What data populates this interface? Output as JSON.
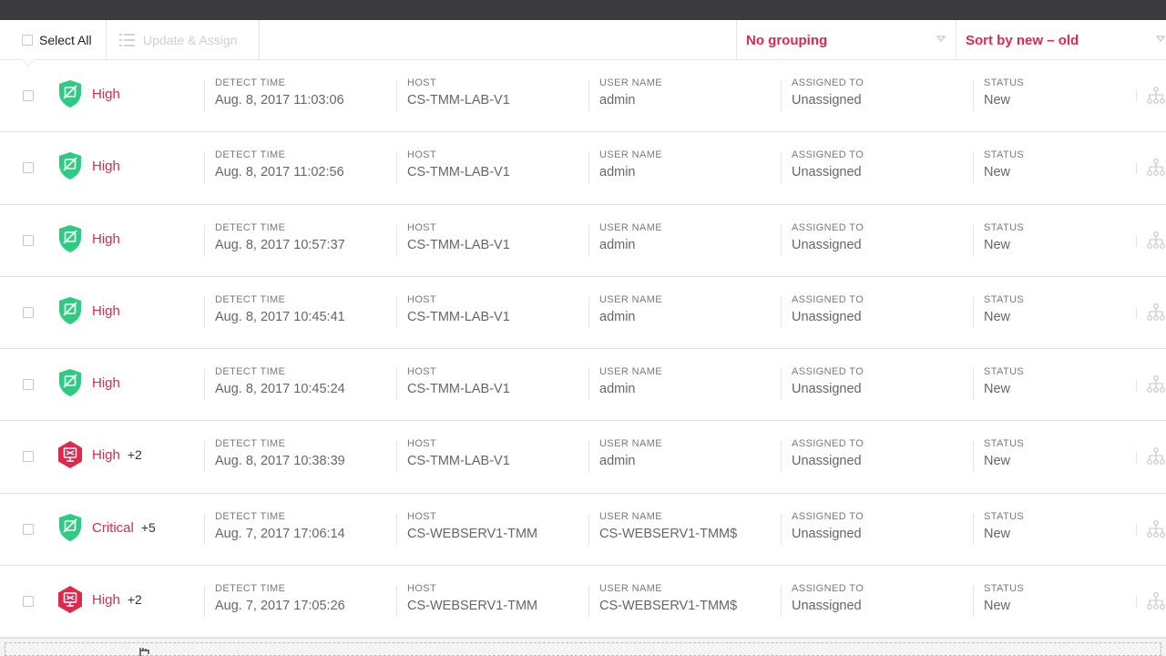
{
  "toolbar": {
    "select_all_label": "Select All",
    "update_assign_label": "Update & Assign",
    "grouping_label": "No grouping",
    "sort_label": "Sort by new – old"
  },
  "columns": {
    "detect_time": "DETECT TIME",
    "host": "HOST",
    "user_name": "USER NAME",
    "assigned_to": "ASSIGNED TO",
    "status": "STATUS"
  },
  "colors": {
    "accent": "#e0284e",
    "green_shield": "#2ecc80",
    "red_hex": "#e0284e"
  },
  "detections": [
    {
      "icon": "green-shield-icon",
      "severity": "High",
      "extra": "",
      "detect_time": "Aug. 8, 2017 11:03:06",
      "host": "CS-TMM-LAB-V1",
      "user_name": "admin",
      "assigned_to": "Unassigned",
      "status": "New"
    },
    {
      "icon": "green-shield-icon",
      "severity": "High",
      "extra": "",
      "detect_time": "Aug. 8, 2017 11:02:56",
      "host": "CS-TMM-LAB-V1",
      "user_name": "admin",
      "assigned_to": "Unassigned",
      "status": "New"
    },
    {
      "icon": "green-shield-icon",
      "severity": "High",
      "extra": "",
      "detect_time": "Aug. 8, 2017 10:57:37",
      "host": "CS-TMM-LAB-V1",
      "user_name": "admin",
      "assigned_to": "Unassigned",
      "status": "New"
    },
    {
      "icon": "green-shield-icon",
      "severity": "High",
      "extra": "",
      "detect_time": "Aug. 8, 2017 10:45:41",
      "host": "CS-TMM-LAB-V1",
      "user_name": "admin",
      "assigned_to": "Unassigned",
      "status": "New"
    },
    {
      "icon": "green-shield-icon",
      "severity": "High",
      "extra": "",
      "detect_time": "Aug. 8, 2017 10:45:24",
      "host": "CS-TMM-LAB-V1",
      "user_name": "admin",
      "assigned_to": "Unassigned",
      "status": "New"
    },
    {
      "icon": "red-hexagon-icon",
      "severity": "High",
      "extra": "+2",
      "detect_time": "Aug. 8, 2017 10:38:39",
      "host": "CS-TMM-LAB-V1",
      "user_name": "admin",
      "assigned_to": "Unassigned",
      "status": "New"
    },
    {
      "icon": "green-shield-icon",
      "severity": "Critical",
      "extra": "+5",
      "detect_time": "Aug. 7, 2017 17:06:14",
      "host": "CS-WEBSERV1-TMM",
      "user_name": "CS-WEBSERV1-TMM$",
      "assigned_to": "Unassigned",
      "status": "New"
    },
    {
      "icon": "red-hexagon-icon",
      "severity": "High",
      "extra": "+2",
      "detect_time": "Aug. 7, 2017 17:05:26",
      "host": "CS-WEBSERV1-TMM",
      "user_name": "CS-WEBSERV1-TMM$",
      "assigned_to": "Unassigned",
      "status": "New"
    }
  ]
}
